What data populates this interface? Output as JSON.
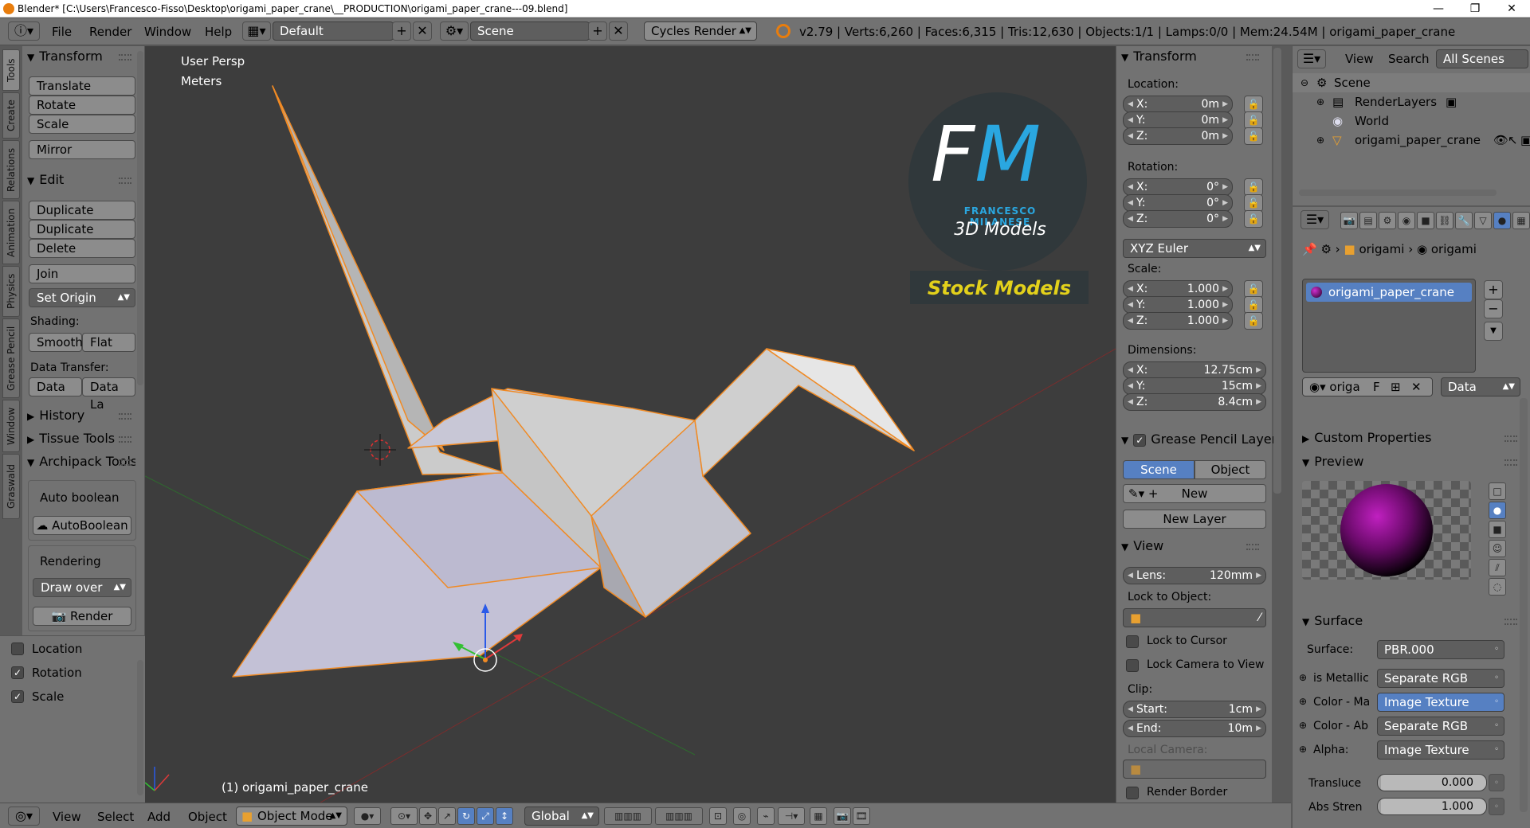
{
  "window": {
    "title": "Blender* [C:\\Users\\Francesco-Fisso\\Desktop\\origami_paper_crane\\__PRODUCTION\\origami_paper_crane---09.blend]",
    "minimize": "—",
    "maximize": "❐",
    "close": "✕"
  },
  "topbar": {
    "menus": [
      "File",
      "Render",
      "Window",
      "Help"
    ],
    "layout": "Default",
    "scene": "Scene",
    "engine": "Cycles Render",
    "stats": "v2.79 | Verts:6,260 | Faces:6,315 | Tris:12,630 | Objects:1/1 | Lamps:0/0 | Mem:24.54M | origami_paper_crane"
  },
  "left_tabs": [
    "Tools",
    "Create",
    "Relations",
    "Animation",
    "Physics",
    "Grease Pencil",
    "Window",
    "Graswald"
  ],
  "tools": {
    "transform_header": "Transform",
    "translate": "Translate",
    "rotate": "Rotate",
    "scale": "Scale",
    "mirror": "Mirror",
    "edit_header": "Edit",
    "duplicate": "Duplicate",
    "duplicate_linked": "Duplicate Linked",
    "delete": "Delete",
    "join": "Join",
    "set_origin": "Set Origin",
    "shading_label": "Shading:",
    "smooth": "Smooth",
    "flat": "Flat",
    "data_transfer_label": "Data Transfer:",
    "data": "Data",
    "data_la": "Data La",
    "history": "History",
    "tissue_tools": "Tissue Tools",
    "archipack_tools": "Archipack Tools",
    "auto_boolean": "Auto boolean",
    "autoboolean_btn": "AutoBoolean",
    "rendering": "Rendering",
    "draw_over": "Draw over",
    "render": "Render"
  },
  "tool_options": {
    "location": "Location",
    "rotation": "Rotation",
    "scale": "Scale"
  },
  "viewport": {
    "view_name": "User Persp",
    "units": "Meters",
    "object_label": "(1) origami_paper_crane",
    "logo": {
      "initials": "FM",
      "name": "FRANCESCO MILANESE",
      "sub": "3D Models",
      "stock": "Stock Models"
    }
  },
  "npanel": {
    "transform_header": "Transform",
    "location_label": "Location:",
    "location": [
      {
        "k": "X:",
        "v": "0m"
      },
      {
        "k": "Y:",
        "v": "0m"
      },
      {
        "k": "Z:",
        "v": "0m"
      }
    ],
    "rotation_label": "Rotation:",
    "rotation": [
      {
        "k": "X:",
        "v": "0°"
      },
      {
        "k": "Y:",
        "v": "0°"
      },
      {
        "k": "Z:",
        "v": "0°"
      }
    ],
    "rotation_mode": "XYZ Euler",
    "scale_label": "Scale:",
    "scale": [
      {
        "k": "X:",
        "v": "1.000"
      },
      {
        "k": "Y:",
        "v": "1.000"
      },
      {
        "k": "Z:",
        "v": "1.000"
      }
    ],
    "dimensions_label": "Dimensions:",
    "dimensions": [
      {
        "k": "X:",
        "v": "12.75cm"
      },
      {
        "k": "Y:",
        "v": "15cm"
      },
      {
        "k": "Z:",
        "v": "8.4cm"
      }
    ],
    "grease_header": "Grease Pencil Layer",
    "scene_btn": "Scene",
    "object_btn": "Object",
    "new_btn": "New",
    "new_layer": "New Layer",
    "view_header": "View",
    "lens": {
      "k": "Lens:",
      "v": "120mm"
    },
    "lock_to_object": "Lock to Object:",
    "lock_to_cursor": "Lock to Cursor",
    "lock_camera": "Lock Camera to View",
    "clip_label": "Clip:",
    "clip_start": {
      "k": "Start:",
      "v": "1cm"
    },
    "clip_end": {
      "k": "End:",
      "v": "10m"
    },
    "local_camera": "Local Camera:",
    "render_border": "Render Border"
  },
  "outliner": {
    "view": "View",
    "search": "Search",
    "all_scenes": "All Scenes",
    "items": [
      "Scene",
      "RenderLayers",
      "World",
      "origami_paper_crane"
    ]
  },
  "properties": {
    "breadcrumb": [
      "origami",
      "origami"
    ],
    "material_slot": "origami_paper_crane",
    "mat_name": "origa",
    "f_btn": "F",
    "data_sel": "Data",
    "custom_props": "Custom Properties",
    "preview": "Preview",
    "surface_header": "Surface",
    "surface_label": "Surface:",
    "surface_value": "PBR.000",
    "rows": [
      {
        "k": "is Metallic",
        "v": "Separate RGB"
      },
      {
        "k": "Color - Ma",
        "v": "Image Texture"
      },
      {
        "k": "Color - Ab",
        "v": "Separate RGB"
      },
      {
        "k": "Alpha:",
        "v": "Image Texture"
      }
    ],
    "transluce": {
      "k": "Transluce",
      "v": "0.000"
    },
    "abs_stren": {
      "k": "Abs Stren",
      "v": "1.000"
    }
  },
  "bottombar": {
    "menus": [
      "View",
      "Select",
      "Add",
      "Object"
    ],
    "mode": "Object Mode",
    "orientation": "Global"
  },
  "colors": {
    "accent": "#5680c2",
    "selected_outline": "#f08a24",
    "logo_blue": "#2aa7e0",
    "stock_yellow": "#e3d11b"
  }
}
